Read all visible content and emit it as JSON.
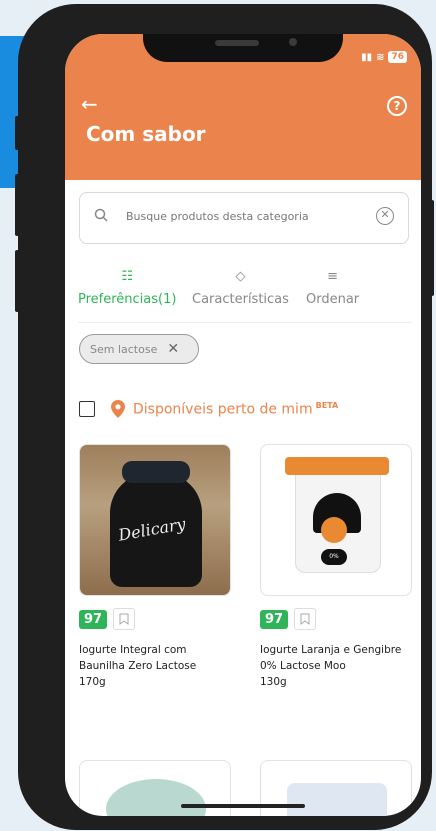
{
  "status": {
    "battery": "76"
  },
  "header": {
    "title": "Com sabor"
  },
  "search": {
    "placeholder": "Busque produtos desta categoria"
  },
  "tabs": [
    {
      "label": "Preferências(1)",
      "icon": "sliders-icon",
      "active": true
    },
    {
      "label": "Características",
      "icon": "tag-icon",
      "active": false
    },
    {
      "label": "Ordenar",
      "icon": "sort-icon",
      "active": false
    }
  ],
  "filter_chip": {
    "label": "Sem lactose"
  },
  "nearby": {
    "label": "Disponíveis perto de mim",
    "badge": "BETA"
  },
  "products": [
    {
      "score": "97",
      "name": "Iogurte Integral com Baunilha Zero Lactose",
      "weight": "170g",
      "image_text": "Delicary"
    },
    {
      "score": "97",
      "name": "Iogurte Laranja e Gengibre 0% Lactose Moo",
      "weight": "130g",
      "image_text": "0%"
    }
  ],
  "colors": {
    "brand": "#ea844c",
    "accent_green": "#2fb45a"
  }
}
